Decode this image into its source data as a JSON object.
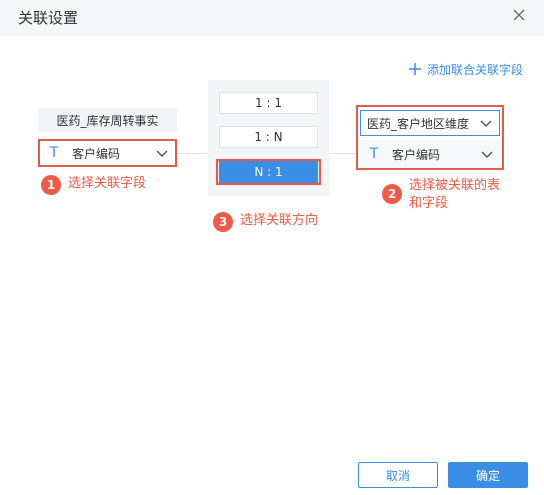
{
  "dialog": {
    "title": "关联设置"
  },
  "add_link": {
    "label": "添加联合关联字段"
  },
  "left": {
    "table_name": "医药_库存周转事实",
    "field_type_icon": "T",
    "field_name": "客户编码"
  },
  "relation": {
    "options": [
      "1 : 1",
      "1 : N",
      "N : 1"
    ],
    "selected": "N : 1"
  },
  "right": {
    "table_select": "医药_客户地区维度",
    "field_type_icon": "T",
    "field_name": "客户编码"
  },
  "steps": [
    {
      "num": "1",
      "text": "选择关联字段"
    },
    {
      "num": "2",
      "text": "选择被关联的表和字段"
    },
    {
      "num": "3",
      "text": "选择关联方向"
    }
  ],
  "footer": {
    "cancel": "取消",
    "confirm": "确定"
  },
  "colors": {
    "accent": "#3a8ee6",
    "annotation": "#ef5b46",
    "header_bg": "#f5f6f7"
  }
}
